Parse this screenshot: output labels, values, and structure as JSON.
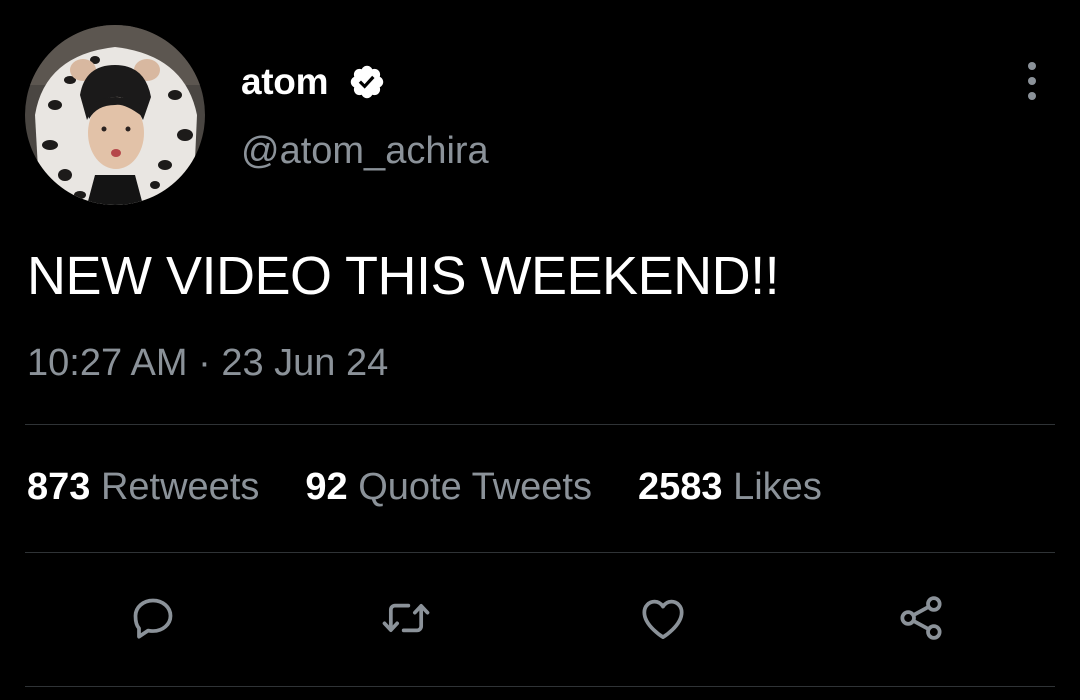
{
  "user": {
    "display_name": "atom",
    "handle": "@atom_achira",
    "verified": true,
    "avatar_icon": "profile-photo"
  },
  "tweet": {
    "text": "NEW VIDEO THIS WEEKEND!!",
    "timestamp": "10:27 AM · 23 Jun 24"
  },
  "stats": {
    "retweets": {
      "count": "873",
      "label": "Retweets"
    },
    "quote_tweets": {
      "count": "92",
      "label": "Quote Tweets"
    },
    "likes": {
      "count": "2583",
      "label": "Likes"
    }
  },
  "actions": [
    {
      "name": "reply",
      "icon": "reply-icon"
    },
    {
      "name": "retweet",
      "icon": "retweet-icon"
    },
    {
      "name": "like",
      "icon": "heart-icon"
    },
    {
      "name": "share",
      "icon": "share-icon"
    }
  ],
  "colors": {
    "background": "#000000",
    "primary_text": "#ffffff",
    "secondary_text": "#8b9299",
    "divider": "#2f3336"
  }
}
